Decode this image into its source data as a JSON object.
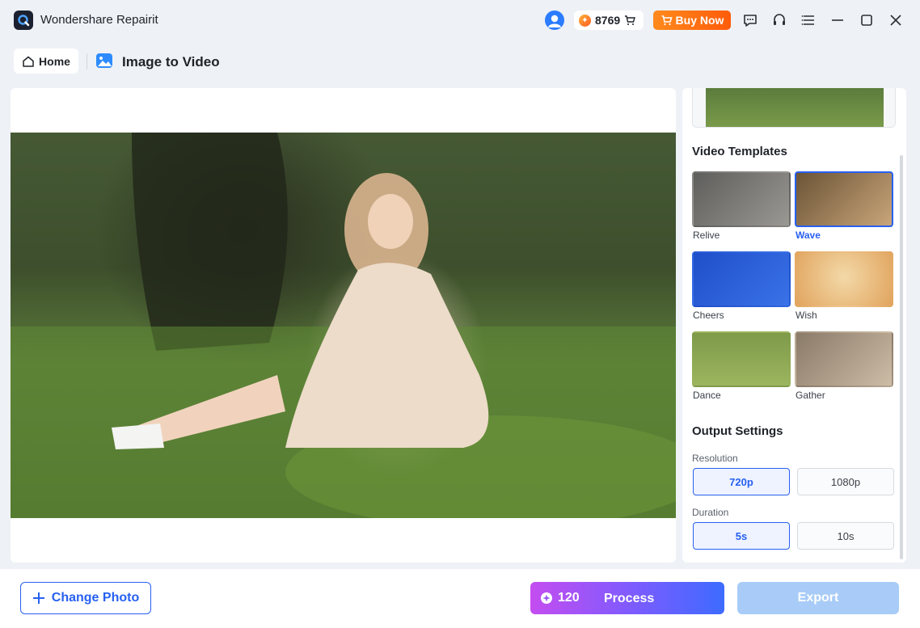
{
  "app": {
    "title": "Wondershare Repairit",
    "credits": "8769",
    "buy_now": "Buy Now"
  },
  "breadcrumb": {
    "home": "Home",
    "page_title": "Image to Video"
  },
  "templates": {
    "title": "Video Templates",
    "items": [
      {
        "label": "Relive",
        "selected": false
      },
      {
        "label": "Wave",
        "selected": true
      },
      {
        "label": "Cheers",
        "selected": false
      },
      {
        "label": "Wish",
        "selected": false
      },
      {
        "label": "Dance",
        "selected": false
      },
      {
        "label": "Gather",
        "selected": false
      }
    ]
  },
  "output": {
    "title": "Output Settings",
    "resolution_label": "Resolution",
    "resolution_options": [
      "720p",
      "1080p"
    ],
    "resolution_selected": "720p",
    "duration_label": "Duration",
    "duration_options": [
      "5s",
      "10s"
    ],
    "duration_selected": "5s"
  },
  "footer": {
    "change_photo": "Change Photo",
    "process_cost": "120",
    "process": "Process",
    "export": "Export"
  },
  "colors": {
    "accent": "#2860f0",
    "buy_now": "#ff7512",
    "export_disabled": "#a8ccf7"
  },
  "icons": {
    "logo": "repairit-logo-icon",
    "account": "user-avatar-icon",
    "coin": "coin-icon",
    "cart": "cart-icon",
    "feedback": "chat-icon",
    "support": "headset-icon",
    "menu": "menu-icon",
    "minimize": "minimize-icon",
    "maximize": "maximize-icon",
    "close": "close-icon"
  }
}
